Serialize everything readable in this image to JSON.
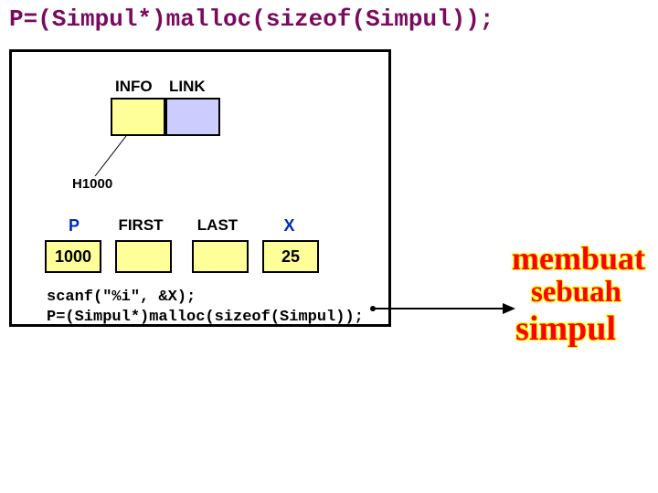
{
  "title": "P=(Simpul*)malloc(sizeof(Simpul));",
  "node": {
    "col_info": "INFO",
    "col_link": "LINK",
    "address": "H1000"
  },
  "vars": {
    "P": {
      "header": "P",
      "value": "1000"
    },
    "FIRST": {
      "header": "FIRST",
      "value": ""
    },
    "LAST": {
      "header": "LAST",
      "value": ""
    },
    "X": {
      "header": "X",
      "value": "25"
    }
  },
  "code": "scanf(\"%i\", &X);\nP=(Simpul*)malloc(sizeof(Simpul));",
  "tagline": {
    "w1": "membuat",
    "w2": "sebuah",
    "w3": "simpul"
  }
}
